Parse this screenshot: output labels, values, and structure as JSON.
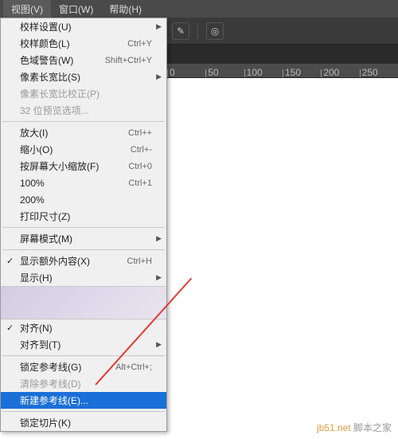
{
  "menubar": {
    "view": "视图(V)",
    "window": "窗口(W)",
    "help": "帮助(H)"
  },
  "ruler": {
    "marks": [
      "0",
      "50",
      "100",
      "150",
      "200",
      "250"
    ]
  },
  "menu": {
    "proofSetup": "校样设置(U)",
    "proofColors": "校样颜色(L)",
    "proofColors_sc": "Ctrl+Y",
    "gamut": "色域警告(W)",
    "gamut_sc": "Shift+Ctrl+Y",
    "pixelAspect": "像素长宽比(S)",
    "pixelAspectCorr": "像素长宽比校正(P)",
    "bit32": "32 位预览选项...",
    "zoomIn": "放大(I)",
    "zoomIn_sc": "Ctrl++",
    "zoomOut": "缩小(O)",
    "zoomOut_sc": "Ctrl+-",
    "fitScreen": "按屏幕大小缩放(F)",
    "fitScreen_sc": "Ctrl+0",
    "p100": "100%",
    "p100_sc": "Ctrl+1",
    "p200": "200%",
    "printSize": "打印尺寸(Z)",
    "screenMode": "屏幕模式(M)",
    "extras": "显示额外内容(X)",
    "extras_sc": "Ctrl+H",
    "show": "显示(H)",
    "snap": "对齐(N)",
    "snapTo": "对齐到(T)",
    "lockGuides": "锁定参考线(G)",
    "lockGuides_sc": "Alt+Ctrl+;",
    "clearGuides": "清除参考线(D)",
    "newGuide": "新建参考线(E)...",
    "lockSlices": "锁定切片(K)"
  },
  "watermark": {
    "site": "jb51.net",
    "text": " 脚本之家"
  }
}
